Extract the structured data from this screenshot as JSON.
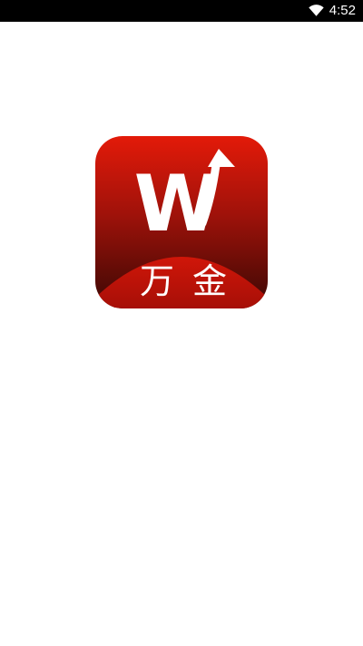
{
  "status_bar": {
    "time": "4:52",
    "wifi_icon": "wifi-icon"
  },
  "splash": {
    "logo_icon": "wanjin-logo-icon",
    "logo_letter": "W",
    "logo_text": "万金",
    "colors": {
      "logo_top": "#e31a09",
      "logo_bottom": "#3a0804",
      "logo_arc": "#c41208",
      "background": "#ffffff"
    }
  }
}
